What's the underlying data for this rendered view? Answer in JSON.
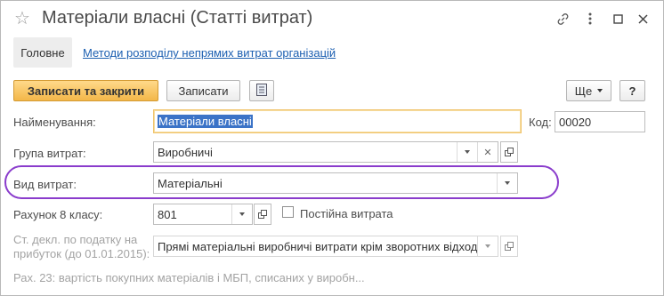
{
  "window": {
    "title": "Матеріали власні (Статті витрат)"
  },
  "nav": {
    "main_tab": "Головне",
    "link": "Методи розподілу непрямих витрат організацій"
  },
  "toolbar": {
    "save_close": "Записати та закрити",
    "save": "Записати",
    "more": "Ще",
    "help": "?"
  },
  "form": {
    "name_label": "Найменування:",
    "name_value": "Матеріали власні",
    "code_label": "Код:",
    "code_value": "00020",
    "group_label": "Група витрат:",
    "group_value": "Виробничі",
    "type_label": "Вид витрат:",
    "type_value": "Матеріальні",
    "account_label": "Рахунок 8 класу:",
    "account_value": "801",
    "permanent_label": "Постійна витрата",
    "tax_label_line1": "Ст. декл. по податку на",
    "tax_label_line2": "прибуток (до 01.01.2015):",
    "tax_value": "Прямі матеріальні виробничі витрати крім зворотних відході",
    "note": "Рах. 23: вартість покупних матеріалів і МБП, списаних у виробн..."
  },
  "icons": {
    "star": "star-icon",
    "link": "link-icon",
    "more": "more-vertical-icon",
    "maximize": "maximize-icon",
    "close": "close-icon"
  },
  "colors": {
    "primary_button": "#f3b749",
    "link": "#1c5fb1",
    "highlight_ring": "#8a3ccc",
    "active_field_border": "#f0c36a"
  }
}
